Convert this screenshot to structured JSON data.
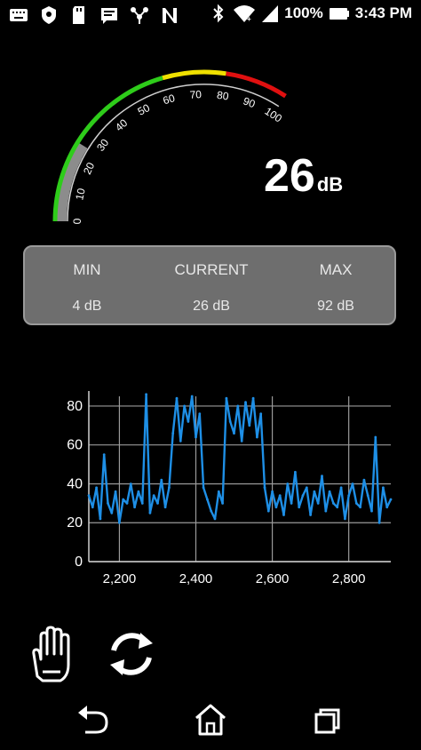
{
  "status_bar": {
    "left_icons": [
      "keyboard-icon",
      "shield-icon",
      "sd-card-icon",
      "message-icon",
      "network-icon",
      "n-icon"
    ],
    "right_icons": [
      "bluetooth-icon",
      "wifi-icon",
      "cell-signal-icon"
    ],
    "battery_percent": "100%",
    "battery_level": 1.0,
    "time": "3:43 PM"
  },
  "gauge": {
    "ticks": [
      "0",
      "10",
      "20",
      "30",
      "40",
      "50",
      "60",
      "70",
      "80",
      "90",
      "100"
    ],
    "value": 26,
    "range": [
      0,
      100
    ],
    "colors": {
      "low": "#2ecc1a",
      "mid": "#f0e000",
      "high": "#e01010",
      "needle": "#8c8c8c"
    },
    "zones": [
      [
        0,
        60,
        "low"
      ],
      [
        60,
        80,
        "mid"
      ],
      [
        80,
        100,
        "high"
      ]
    ]
  },
  "reading": {
    "value": "26",
    "unit": "dB"
  },
  "stats": [
    {
      "label": "MIN",
      "value": "4 dB"
    },
    {
      "label": "CURRENT",
      "value": "26 dB"
    },
    {
      "label": "MAX",
      "value": "92 dB"
    }
  ],
  "chart_data": {
    "type": "line",
    "title": "",
    "xlabel": "",
    "ylabel": "",
    "x_range": [
      2120,
      2910
    ],
    "ylim": [
      0,
      85
    ],
    "y_ticks": [
      "0",
      "20",
      "40",
      "60",
      "80"
    ],
    "x_ticks": [
      "2,200",
      "2,400",
      "2,600",
      "2,800"
    ],
    "x_tick_values": [
      2200,
      2400,
      2600,
      2800
    ],
    "grid": true,
    "color": "#1e8fe6",
    "series": [
      {
        "x": [
          2120,
          2130,
          2140,
          2150,
          2160,
          2170,
          2180,
          2190,
          2200,
          2210,
          2220,
          2230,
          2240,
          2250,
          2260,
          2270,
          2280,
          2290,
          2300,
          2310,
          2320,
          2330,
          2340,
          2350,
          2360,
          2370,
          2380,
          2390,
          2400,
          2410,
          2420,
          2430,
          2440,
          2450,
          2460,
          2470,
          2480,
          2490,
          2500,
          2510,
          2520,
          2530,
          2540,
          2550,
          2560,
          2570,
          2580,
          2590,
          2600,
          2610,
          2620,
          2630,
          2640,
          2650,
          2660,
          2670,
          2680,
          2690,
          2700,
          2710,
          2720,
          2730,
          2740,
          2750,
          2760,
          2770,
          2780,
          2790,
          2800,
          2810,
          2820,
          2830,
          2840,
          2850,
          2860,
          2870,
          2880,
          2890,
          2900,
          2910
        ],
        "y": [
          34,
          28,
          38,
          22,
          55,
          30,
          25,
          36,
          20,
          32,
          30,
          40,
          28,
          36,
          30,
          86,
          25,
          34,
          30,
          42,
          28,
          38,
          66,
          84,
          62,
          80,
          72,
          85,
          64,
          76,
          38,
          32,
          26,
          22,
          36,
          30,
          84,
          72,
          66,
          80,
          62,
          82,
          70,
          84,
          64,
          76,
          38,
          26,
          36,
          28,
          34,
          24,
          40,
          30,
          46,
          28,
          34,
          38,
          24,
          36,
          30,
          44,
          26,
          36,
          30,
          28,
          38,
          22,
          34,
          40,
          30,
          28,
          42,
          34,
          26,
          64,
          20,
          38,
          28,
          32
        ]
      }
    ]
  },
  "controls": {
    "left": "hand-icon",
    "right": "refresh-icon"
  },
  "nav": {
    "back": "back-icon",
    "home": "home-icon",
    "recents": "recents-icon"
  }
}
